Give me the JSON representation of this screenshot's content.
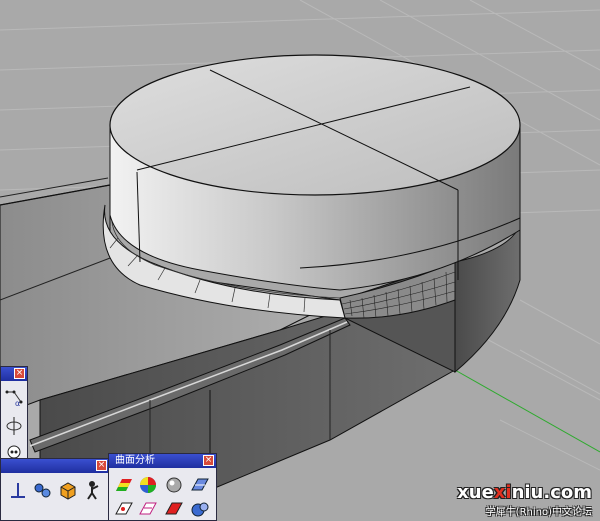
{
  "panels": {
    "left": {
      "close_label": "×"
    },
    "bottom": {
      "close_label": "×"
    },
    "analysis": {
      "title": "曲面分析",
      "close_label": "×"
    }
  },
  "tools": {
    "left": [
      "curve-points-icon",
      "circle-axis-icon",
      "skull-icon"
    ],
    "bottom": [
      "line-tool-icon",
      "gears-icon",
      "box-tool-icon",
      "worker-icon"
    ],
    "analysis_row1": [
      "zebra-icon",
      "curvature-sphere-icon",
      "env-map-icon",
      "draft-angle-icon"
    ],
    "analysis_row2": [
      "point-check-icon",
      "edge-check-icon",
      "emap-icon",
      "object-check-icon"
    ]
  },
  "watermark": {
    "site_prefix": "xue",
    "site_highlight": "xi",
    "site_suffix": "niu.com",
    "forum": "学犀牛(Rhino)中文论坛"
  },
  "colors": {
    "viewport_bg": "#a9a9a9",
    "grid_line": "#b8b8b8",
    "green_axis": "#2eaa2e",
    "titlebar": "#2535b8",
    "accent_red": "#e03020"
  }
}
